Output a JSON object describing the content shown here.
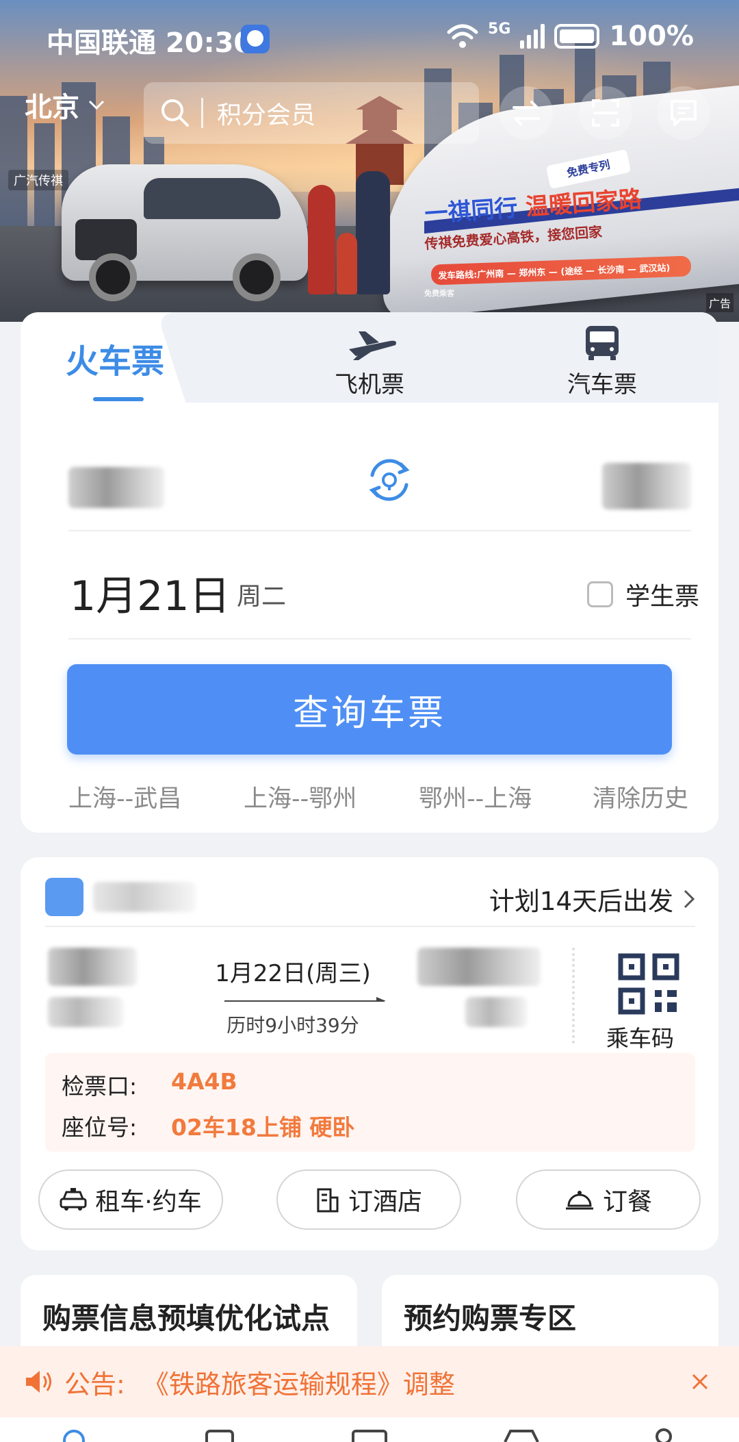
{
  "status_bar": {
    "carrier_time": "中国联通 20:30",
    "network": "5G",
    "battery": "100%"
  },
  "header": {
    "city": "北京",
    "search_placeholder": "积分会员"
  },
  "banner": {
    "brand": "广汽传祺",
    "headline_part1": "一祺同行",
    "headline_part2": "温暖回家路",
    "subline": "传祺免费爱心高铁，接您回家",
    "route_bar": "发车路线:广州南 — 郑州东 — (途经 — 长沙南 — 武汉站)",
    "ribbon": "免费专列",
    "small_print": "免费乘客",
    "ad_label": "广告"
  },
  "ticket_tabs": {
    "train": "火车票",
    "flight": "飞机票",
    "bus": "汽车票"
  },
  "booking": {
    "date": "1月21日",
    "weekday": "周二",
    "student_ticket": "学生票",
    "search_button": "查询车票",
    "history": [
      "上海--武昌",
      "上海--鄂州",
      "鄂州--上海"
    ],
    "clear_history": "清除历史"
  },
  "trip": {
    "plan": "计划14天后出发",
    "date": "1月22日(周三)",
    "duration": "历时9小时39分",
    "ride_code": "乘车码",
    "gate_label": "检票口:",
    "gate_value": "4A4B",
    "seat_label": "座位号:",
    "seat_value": "02车18上铺 硬卧"
  },
  "services": {
    "car": "租车·约车",
    "hotel": "订酒店",
    "meal": "订餐"
  },
  "cards": {
    "left": "购票信息预填优化试点",
    "right": "预约购票专区"
  },
  "notice": {
    "label": "公告:",
    "text": "《铁路旅客运输规程》调整"
  },
  "colors": {
    "accent": "#3d8ce6",
    "button": "#4f8ff5",
    "orange": "#f17a3d"
  }
}
